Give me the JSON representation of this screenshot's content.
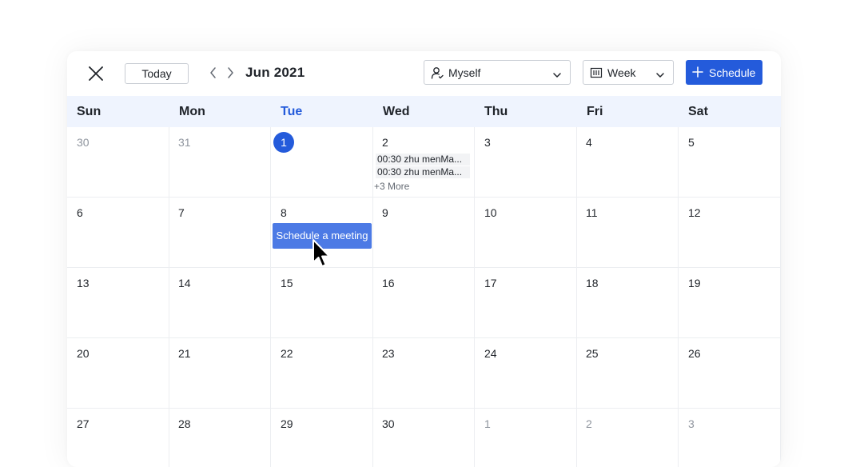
{
  "toolbar": {
    "today_label": "Today",
    "month_title": "Jun 2021",
    "person_select": "Myself",
    "view_select": "Week",
    "schedule_label": "Schedule"
  },
  "weekdays": [
    "Sun",
    "Mon",
    "Tue",
    "Wed",
    "Thu",
    "Fri",
    "Sat"
  ],
  "active_weekday": "Tue",
  "weeks": [
    [
      "30",
      "31",
      "1",
      "2",
      "3",
      "4",
      "5"
    ],
    [
      "6",
      "7",
      "8",
      "9",
      "10",
      "11",
      "12"
    ],
    [
      "13",
      "14",
      "15",
      "16",
      "17",
      "18",
      "19"
    ],
    [
      "20",
      "21",
      "22",
      "23",
      "24",
      "25",
      "26"
    ],
    [
      "27",
      "28",
      "29",
      "30",
      "1",
      "2",
      "3"
    ]
  ],
  "events": {
    "wed_2": [
      "00:30 zhu menMa...",
      "00:30 zhu menMa..."
    ],
    "wed_2_more": "+3 More"
  },
  "meeting_label": "Schedule a meeting",
  "colors": {
    "accent": "#245bdb",
    "header_bg": "#eff4fe",
    "meeting_bg": "#4c7ae5"
  }
}
